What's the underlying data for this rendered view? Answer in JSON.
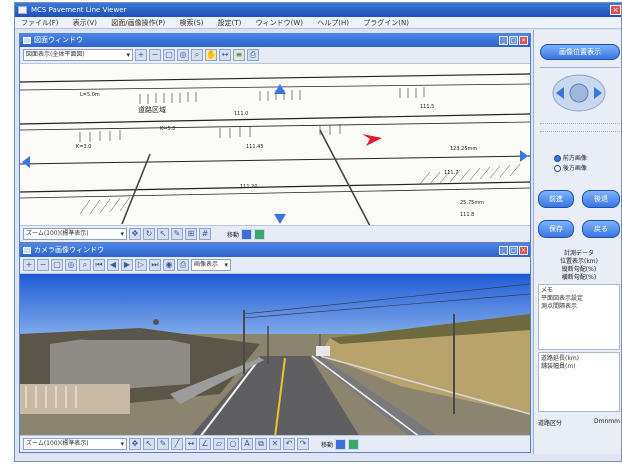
{
  "app": {
    "title": "MCS Pavement Line Viewer",
    "menu": [
      "ファイル(F)",
      "表示(V)",
      "図面/画像操作(P)",
      "検索(S)",
      "設定(T)",
      "ウィンドウ(W)",
      "ヘルプ(H)",
      "プラグイン(N)"
    ]
  },
  "drawing_panel": {
    "title": "図面ウィンドウ",
    "select_value": "図面表示(全体平面図)",
    "bottom_select": "ズーム(100)(標準表示)",
    "bottom_label": "移動",
    "labels": [
      "道路区域",
      "L=5.0m",
      "111.0",
      "K=5.0",
      "K=3.0",
      "111.45",
      "111.5",
      "111.20",
      "111.7",
      "123.25mm",
      "25.75mm",
      "111.8"
    ]
  },
  "photo_panel": {
    "title": "カメラ画像ウィンドウ",
    "select_value": "画像表示",
    "bottom_select": "ズーム(100)(標準表示)",
    "bottom_label": "移動"
  },
  "side_panel": {
    "top_button": "画像位置表示",
    "buttons": [
      "前進",
      "後退",
      "保存",
      "戻る"
    ],
    "radio_options": [
      "前方画像",
      "後方画像"
    ],
    "info_title": "計測データ",
    "info_lines": [
      "位置表示(km)",
      "縦断勾配(%)",
      "横断勾配(%)"
    ],
    "memo_title": "メモ",
    "memo_lines": [
      "平面図表示設定",
      "測点間隔表示"
    ],
    "detail_lines": [
      "道路延長(km)",
      "舗装幅員(m)"
    ],
    "footer_left": "道路区分",
    "footer_right": "Dmnmm"
  },
  "colors": {
    "titlebar": "#2e63c6",
    "accent": "#3a76e0",
    "arrow": "#e8192c"
  }
}
